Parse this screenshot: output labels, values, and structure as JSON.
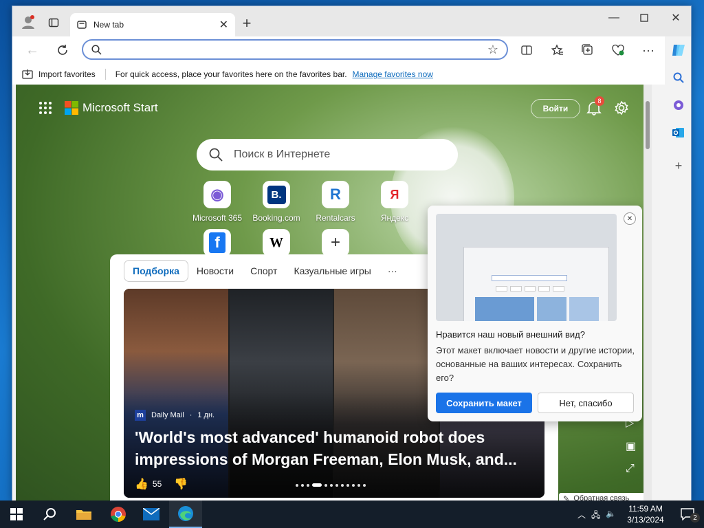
{
  "window": {
    "tab_title": "New tab",
    "new_tab_symbol": "+"
  },
  "address": {
    "value": "",
    "placeholder": ""
  },
  "favbar": {
    "import_label": "Import favorites",
    "hint_text": "For quick access, place your favorites here on the favorites bar.",
    "manage_link": "Manage favorites now"
  },
  "start": {
    "brand": "Microsoft Start",
    "signin_label": "Войти",
    "notifications_count": "8",
    "search_placeholder": "Поиск в Интернете",
    "tiles": [
      {
        "label": "Microsoft 365",
        "glyph": "◉",
        "color": "#7b5bd6"
      },
      {
        "label": "Booking.com",
        "glyph": "B.",
        "color": "#003580"
      },
      {
        "label": "Rentalcars",
        "glyph": "R",
        "color": "#1f74d1"
      },
      {
        "label": "Яндекс",
        "glyph": "Я",
        "color": "#e3272c"
      },
      {
        "label": "",
        "glyph": "f",
        "color": "#1877f2"
      },
      {
        "label": "",
        "glyph": "W",
        "color": "#000000"
      },
      {
        "label": "",
        "glyph": "+",
        "color": "#333333"
      }
    ]
  },
  "feed": {
    "tabs": [
      "Подборка",
      "Новости",
      "Спорт",
      "Казуальные игры",
      "···"
    ],
    "source_name": "Daily Mail",
    "source_time": "1 дн.",
    "source_icon": "m",
    "headline": "'World's most advanced' humanoid robot does impressions of Morgan Freeman, Elon Musk, and...",
    "likes": "55"
  },
  "popup": {
    "title": "Нравится наш новый внешний вид?",
    "body": "Этот макет включает новости и другие истории, основанные на ваших интересах. Сохранить его?",
    "save_label": "Сохранить макет",
    "decline_label": "Нет, спасибо"
  },
  "right_controls": {
    "play": "▷",
    "image": "▣",
    "expand": "⤢"
  },
  "feedback_label": "Обратная связь",
  "taskbar": {
    "time": "11:59 AM",
    "date": "3/13/2024",
    "notif_count": "2"
  },
  "colors": {
    "accent": "#0f6cbd",
    "primary_button": "#1a73e8",
    "badge": "#e74c3c"
  }
}
